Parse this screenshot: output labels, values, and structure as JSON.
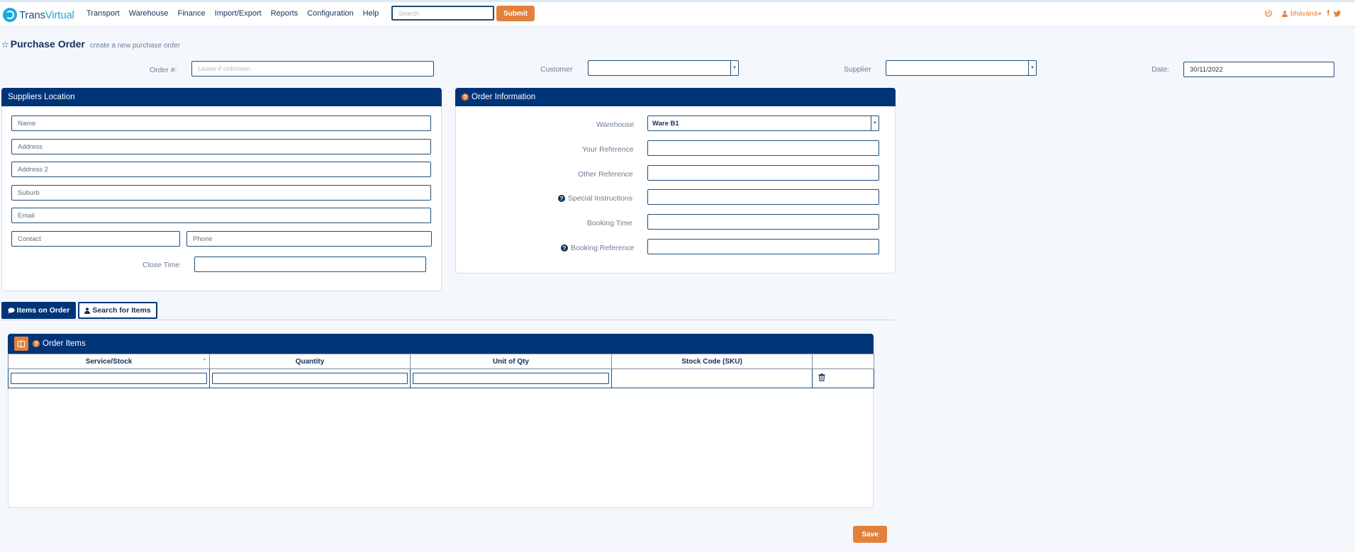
{
  "brand": {
    "part1": "Trans",
    "part2": "Virtual"
  },
  "nav": {
    "items": [
      "Transport",
      "Warehouse",
      "Finance",
      "Import/Export",
      "Reports",
      "Configuration",
      "Help"
    ],
    "search_placeholder": "Search",
    "submit_label": "Submit",
    "user": "bhavana",
    "user_caret": "▾",
    "facebook": "f"
  },
  "page": {
    "title": "Purchase Order",
    "subtitle": "create a new purchase order"
  },
  "header_fields": {
    "order_label": "Order #:",
    "order_placeholder": "Leave if unknown",
    "customer_label": "Customer",
    "customer_value": "",
    "supplier_label": "Supplier",
    "supplier_value": "",
    "date_label": "Date:",
    "date_value": "30/11/2022"
  },
  "suppliers_location": {
    "title": "Suppliers Location",
    "name_placeholder": "Name",
    "address_placeholder": "Address",
    "address2_placeholder": "Address 2",
    "suburb_placeholder": "Suburb",
    "email_placeholder": "Email",
    "contact_placeholder": "Contact",
    "phone_placeholder": "Phone",
    "close_time_label": "Close Time"
  },
  "order_information": {
    "title": "Order Information",
    "warehouse_label": "Warehouse",
    "warehouse_value": "Ware B1",
    "your_reference_label": "Your Reference",
    "other_reference_label": "Other Reference",
    "special_instructions_label": "Special Instructions",
    "booking_time_label": "Booking Time",
    "booking_reference_label": "Booking Reference"
  },
  "tabs": {
    "items_on_order": "Items on Order",
    "search_for_items": "Search for Items"
  },
  "order_items": {
    "title": "Order Items",
    "columns": [
      "Service/Stock",
      "Quantity",
      "Unit of Qty",
      "Stock Code (SKU)",
      ""
    ]
  },
  "save_label": "Save",
  "colors": {
    "navy": "#003478",
    "accent": "#e3803a",
    "logo_blue": "#1aa9e0"
  }
}
